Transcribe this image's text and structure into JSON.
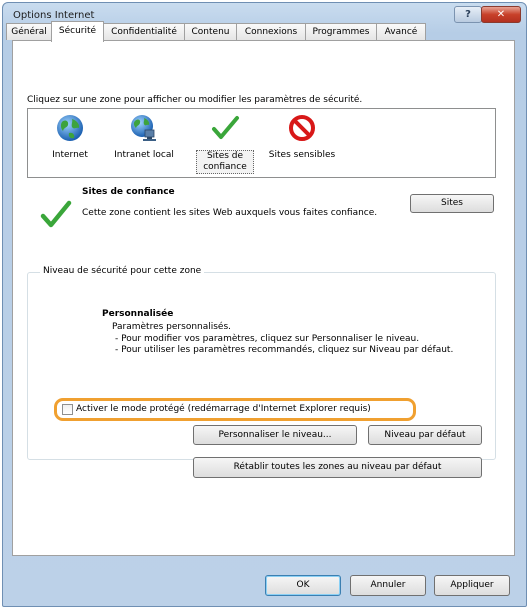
{
  "window": {
    "title": "Options Internet",
    "help_label": "?",
    "close_label": "✕"
  },
  "tabs": [
    {
      "label": "Général"
    },
    {
      "label": "Sécurité",
      "active": true
    },
    {
      "label": "Confidentialité"
    },
    {
      "label": "Contenu"
    },
    {
      "label": "Connexions"
    },
    {
      "label": "Programmes"
    },
    {
      "label": "Avancé"
    }
  ],
  "security": {
    "instruction": "Cliquez sur une zone pour afficher ou modifier les paramètres de sécurité.",
    "zones": [
      {
        "label": "Internet",
        "icon": "globe-icon"
      },
      {
        "label": "Intranet local",
        "icon": "intranet-globe-icon"
      },
      {
        "label": "Sites de confiance",
        "icon": "checkmark-icon",
        "selected": true
      },
      {
        "label": "Sites sensibles",
        "icon": "prohibited-icon"
      }
    ],
    "selected_zone": {
      "title": "Sites de confiance",
      "description": "Cette zone contient les sites Web auxquels vous faites confiance."
    },
    "sites_button": "Sites",
    "level_group_label": "Niveau de sécurité pour cette zone",
    "level": {
      "title": "Personnalisée",
      "lines": [
        "Paramètres personnalisés.",
        "- Pour modifier vos paramètres, cliquez sur Personnaliser le niveau.",
        "- Pour utiliser les paramètres recommandés, cliquez sur Niveau par défaut."
      ]
    },
    "protected_mode_label": "Activer le mode protégé (redémarrage d'Internet Explorer requis)",
    "protected_mode_checked": false,
    "custom_level_button": "Personnaliser le niveau...",
    "default_level_button": "Niveau par défaut",
    "reset_all_button": "Rétablir toutes les zones au niveau par défaut"
  },
  "footer": {
    "ok": "OK",
    "cancel": "Annuler",
    "apply": "Appliquer"
  },
  "colors": {
    "highlight": "#f0a030",
    "check_green": "#3aa63a",
    "prohibited_red": "#d81818",
    "title_bar": "#bcd1e8"
  }
}
